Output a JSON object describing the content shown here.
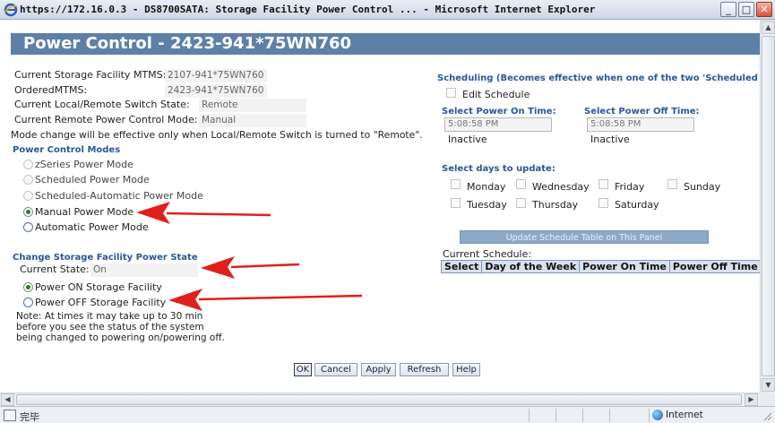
{
  "window": {
    "title": "https://172.16.0.3 - DS8700SATA: Storage Facility Power Control ... - Microsoft Internet Explorer",
    "minimize": "_",
    "maximize": "□",
    "close": "✕"
  },
  "page": {
    "heading": "Power Control - 2423-941*75WN760"
  },
  "info": {
    "mtms_label": "Current Storage Facility MTMS:",
    "mtms_value": "2107-941*75WN760",
    "ordered_label": "OrderedMTMS:",
    "ordered_value": "2423-941*75WN760",
    "switch_label": "Current Local/Remote Switch State:",
    "switch_value": "Remote",
    "mode_label": "Current Remote Power Control Mode:",
    "mode_value": "Manual",
    "note": "Mode change will be effective only when Local/Remote Switch is turned to \"Remote\"."
  },
  "modes": {
    "heading": "Power Control Modes",
    "options": [
      {
        "label": "zSeries Power Mode",
        "state": "disabled"
      },
      {
        "label": "Scheduled Power Mode",
        "state": "disabled"
      },
      {
        "label": "Scheduled-Automatic Power Mode",
        "state": "disabled"
      },
      {
        "label": "Manual Power Mode",
        "state": "checked"
      },
      {
        "label": "Automatic Power Mode",
        "state": "enabled"
      }
    ]
  },
  "power_state": {
    "heading": "Change Storage Facility Power State",
    "current_label": "Current State:",
    "current_value": "On",
    "options": [
      {
        "label": "Power ON Storage Facility",
        "state": "checked"
      },
      {
        "label": "Power OFF Storage Facility",
        "state": "enabled"
      }
    ],
    "note_lines": [
      "Note: At times it may take up to 30 min",
      "before you see the status of the system",
      "being changed to powering on/powering off."
    ]
  },
  "scheduling": {
    "heading": "Scheduling (Becomes effective when one of the two 'Scheduled'",
    "edit_label": "Edit Schedule",
    "on_time_label": "Select Power On Time:",
    "on_time_value": "5:08:58 PM",
    "on_status": "Inactive",
    "off_time_label": "Select Power Off Time:",
    "off_time_value": "5:08:58 PM",
    "off_status": "Inactive",
    "days_heading": "Select days to update:",
    "days": [
      "Monday",
      "Wednesday",
      "Friday",
      "Sunday",
      "Tuesday",
      "Thursday",
      "Saturday"
    ],
    "update_button": "Update Schedule Table on This Panel",
    "current_schedule_label": "Current Schedule:",
    "table_headers": [
      "Select",
      "Day of the Week",
      "Power On Time",
      "Power Off Time"
    ]
  },
  "buttons": {
    "ok": "OK",
    "cancel": "Cancel",
    "apply": "Apply",
    "refresh": "Refresh",
    "help": "Help"
  },
  "statusbar": {
    "text": "完毕",
    "zone": "Internet"
  },
  "colors": {
    "header_bg": "#5e7fa8",
    "section_blue": "#2b5797",
    "arrow_red": "#e0201b"
  }
}
